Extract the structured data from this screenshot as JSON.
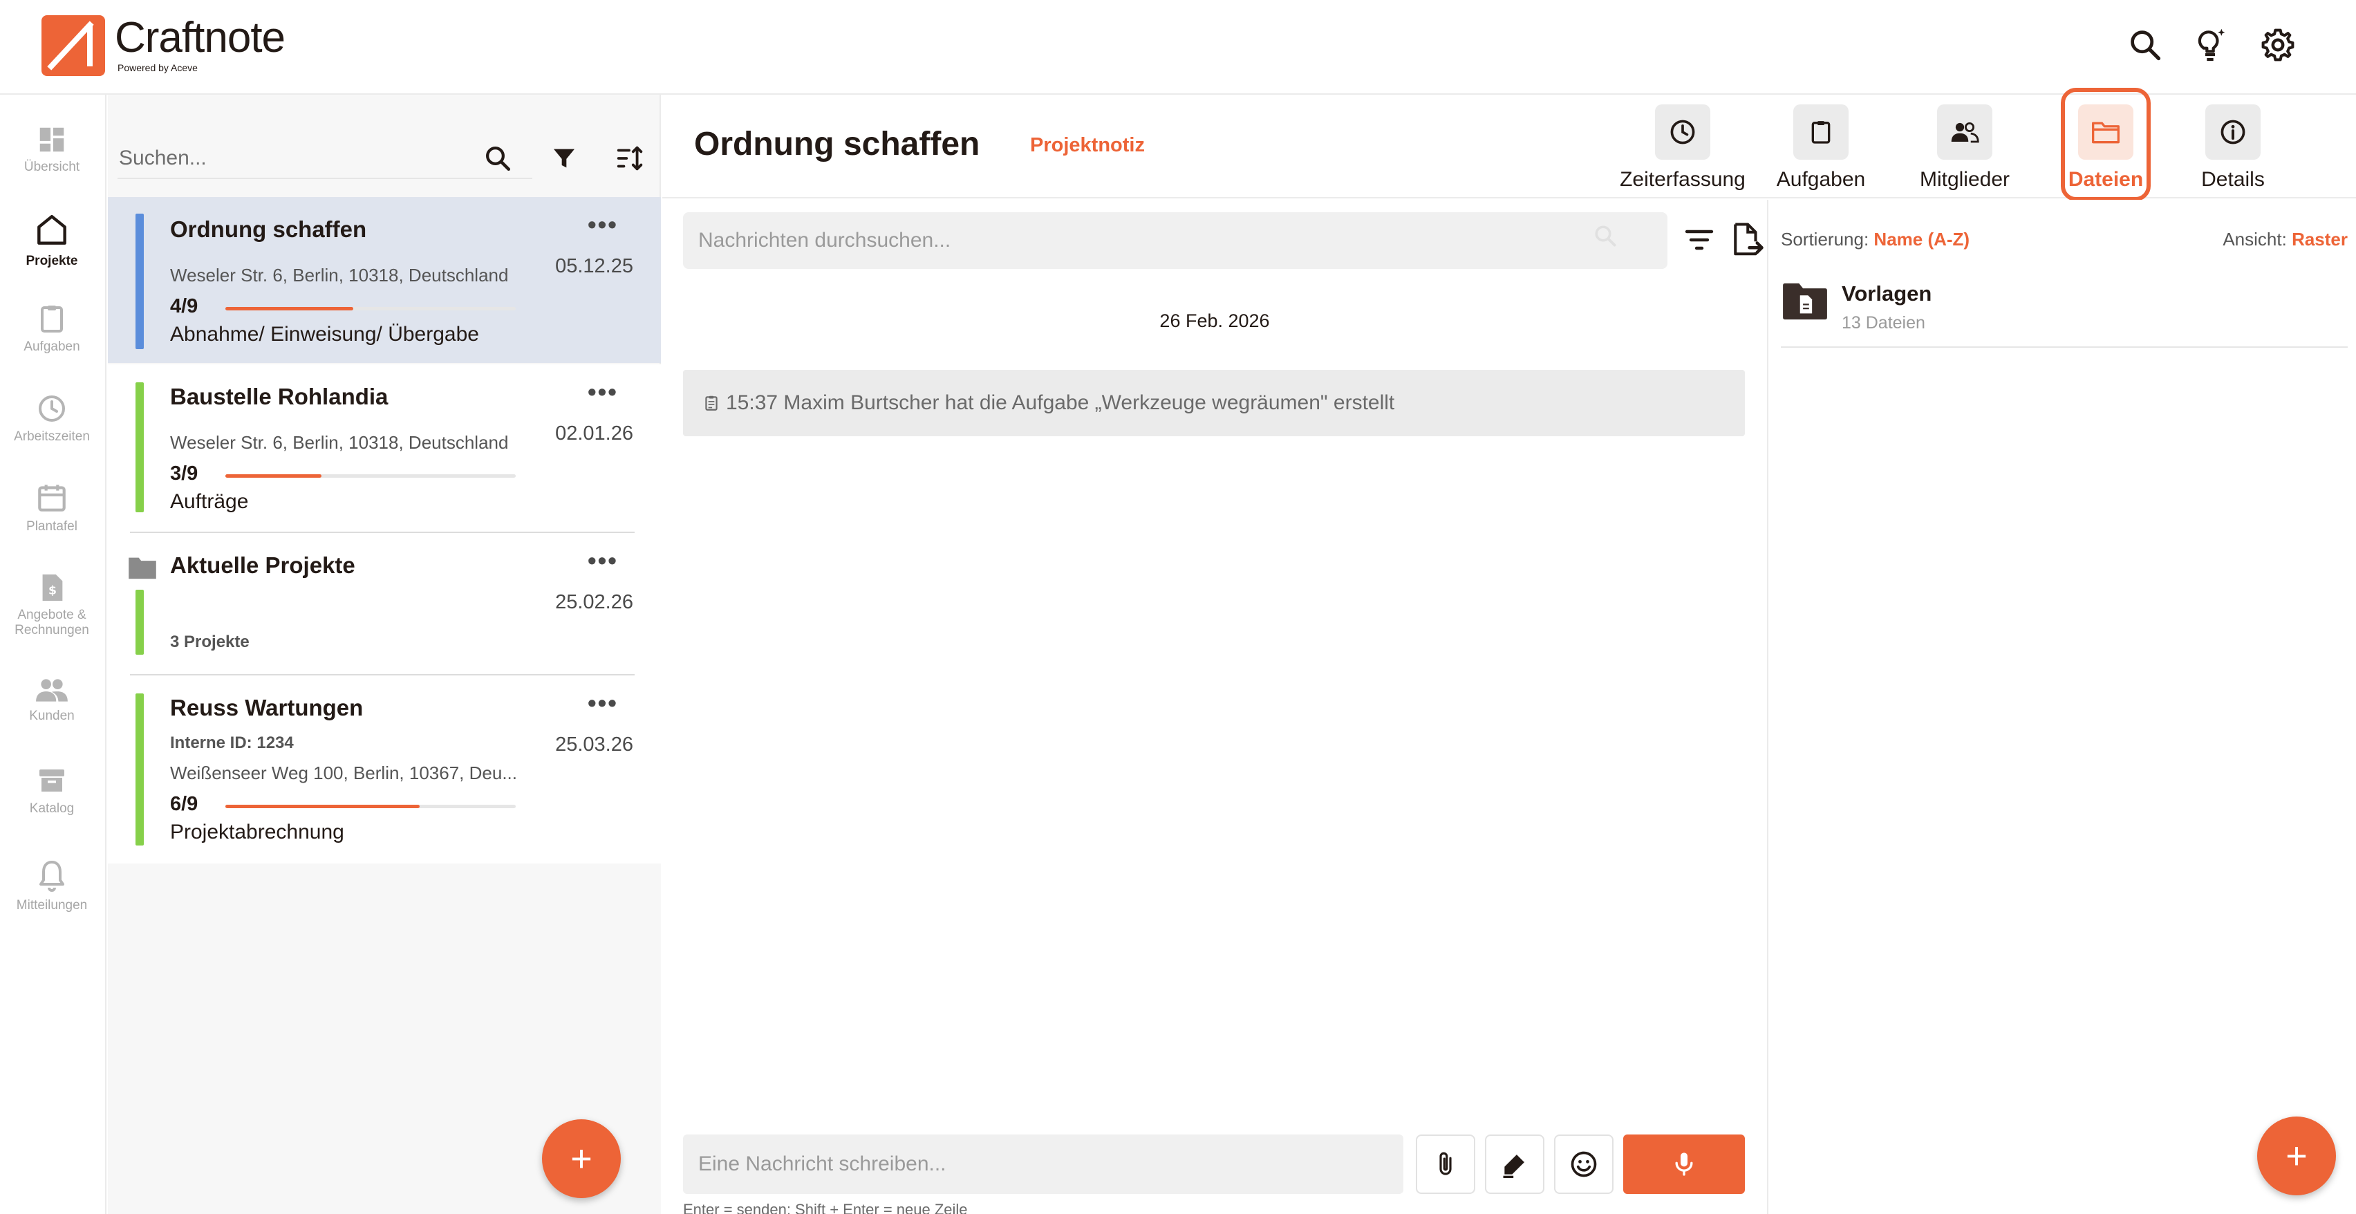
{
  "brand": {
    "name": "Craftnote",
    "tagline": "Powered by Aceve",
    "accent_color": "#ed6437"
  },
  "topbar": {
    "icons": [
      "search-icon",
      "lightbulb-sparkle-icon",
      "gear-icon"
    ]
  },
  "leftnav": {
    "items": [
      {
        "label": "Übersicht",
        "icon": "dashboard-icon",
        "active": false
      },
      {
        "label": "Projekte",
        "icon": "home-icon",
        "active": true
      },
      {
        "label": "Aufgaben",
        "icon": "clipboard-icon",
        "active": false
      },
      {
        "label": "Arbeitszeiten",
        "icon": "clock-icon",
        "active": false
      },
      {
        "label": "Plantafel",
        "icon": "calendar-icon",
        "active": false
      },
      {
        "label": "Angebote & Rechnungen",
        "icon": "invoice-icon",
        "active": false
      },
      {
        "label": "Kunden",
        "icon": "people-icon",
        "active": false
      },
      {
        "label": "Katalog",
        "icon": "archive-icon",
        "active": false
      },
      {
        "label": "Mitteilungen",
        "icon": "bell-icon",
        "active": false
      }
    ]
  },
  "project_list": {
    "search_placeholder": "Suchen...",
    "tools": [
      "search-icon",
      "filter-icon",
      "sort-icon"
    ],
    "items": [
      {
        "title": "Ordnung schaffen",
        "address": "Weseler Str. 6, Berlin, 10318, Deutschland",
        "date": "05.12.25",
        "count": "4/9",
        "progress": 0.44,
        "phase": "Abnahme/ Einweisung/ Übergabe",
        "bar_color": "#5b8ddb",
        "selected": true
      },
      {
        "title": "Baustelle Rohlandia",
        "address": "Weseler Str. 6, Berlin, 10318, Deutschland",
        "date": "02.01.26",
        "count": "3/9",
        "progress": 0.33,
        "phase": "Aufträge",
        "bar_color": "#86d04a",
        "selected": false
      },
      {
        "title": "Aktuelle Projekte",
        "type": "folder",
        "date": "25.02.26",
        "meta": "3 Projekte",
        "bar_color": "#86d04a"
      },
      {
        "title": "Reuss Wartungen",
        "internal_id": "Interne ID: 1234",
        "address": "Weißenseer Weg 100, Berlin, 10367, Deu...",
        "date": "25.03.26",
        "count": "6/9",
        "progress": 0.67,
        "phase": "Projektabrechnung",
        "bar_color": "#86d04a",
        "selected": false
      }
    ],
    "more_label": "•••",
    "fab_label": "+"
  },
  "content": {
    "title": "Ordnung schaffen",
    "subtitle": "Projektnotiz",
    "tabs": [
      {
        "label": "Zeiterfassung",
        "icon": "clock-icon",
        "active": false
      },
      {
        "label": "Aufgaben",
        "icon": "clipboard-icon",
        "active": false
      },
      {
        "label": "Mitglieder",
        "icon": "members-icon",
        "active": false
      },
      {
        "label": "Dateien",
        "icon": "folder-icon",
        "active": true
      },
      {
        "label": "Details",
        "icon": "info-icon",
        "active": false
      }
    ]
  },
  "chat": {
    "search_placeholder": "Nachrichten durchsuchen...",
    "date_separator": "26 Feb. 2026",
    "system_message": "15:37 Maxim Burtscher hat die Aufgabe „Werkzeuge wegräumen\" erstellt",
    "composer_placeholder": "Eine Nachricht schreiben...",
    "composer_hint": "Enter = senden; Shift + Enter = neue Zeile"
  },
  "files": {
    "sort_label": "Sortierung:",
    "sort_value": "Name (A-Z)",
    "view_label": "Ansicht:",
    "view_value": "Raster",
    "folders": [
      {
        "name": "Vorlagen",
        "count": "13 Dateien"
      }
    ],
    "fab_label": "+"
  }
}
